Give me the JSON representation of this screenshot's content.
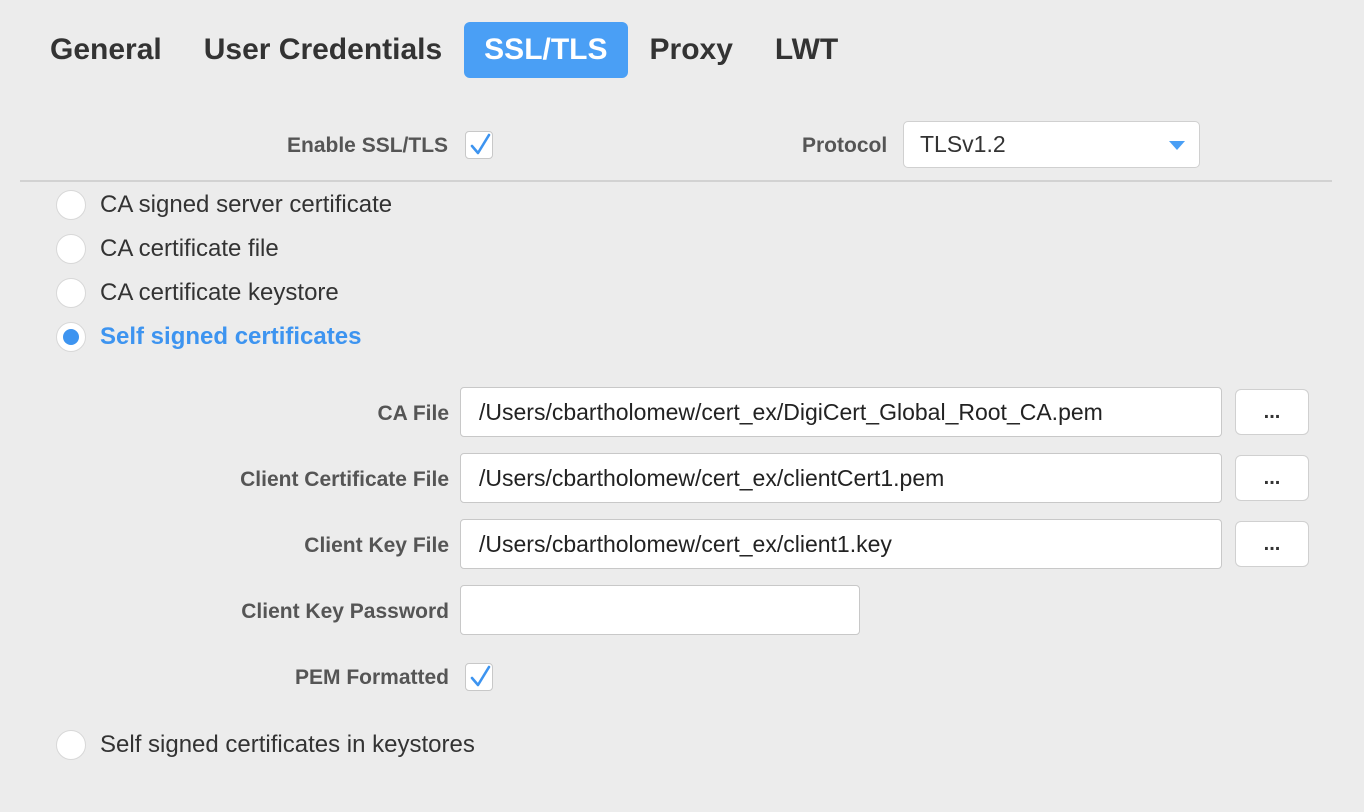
{
  "tabs": [
    {
      "label": "General",
      "active": false
    },
    {
      "label": "User Credentials",
      "active": false
    },
    {
      "label": "SSL/TLS",
      "active": true
    },
    {
      "label": "Proxy",
      "active": false
    },
    {
      "label": "LWT",
      "active": false
    }
  ],
  "ssl": {
    "enable_label": "Enable SSL/TLS",
    "enable_checked": true,
    "protocol_label": "Protocol",
    "protocol_value": "TLSv1.2"
  },
  "cert_options": [
    {
      "label": "CA signed server certificate",
      "checked": false
    },
    {
      "label": "CA certificate file",
      "checked": false
    },
    {
      "label": "CA certificate keystore",
      "checked": false
    },
    {
      "label": "Self signed certificates",
      "checked": true
    }
  ],
  "self_signed": {
    "ca_file_label": "CA File",
    "ca_file_value": "/Users/cbartholomew/cert_ex/DigiCert_Global_Root_CA.pem",
    "client_cert_label": "Client Certificate File",
    "client_cert_value": "/Users/cbartholomew/cert_ex/clientCert1.pem",
    "client_key_label": "Client Key File",
    "client_key_value": "/Users/cbartholomew/cert_ex/client1.key",
    "client_key_password_label": "Client Key Password",
    "client_key_password_value": "",
    "pem_label": "PEM Formatted",
    "pem_checked": true,
    "browse_label": "..."
  },
  "keystore_option": {
    "label": "Self signed certificates in keystores",
    "checked": false
  },
  "colors": {
    "accent": "#4a9ff5",
    "background": "#ececec",
    "label": "#555555"
  }
}
